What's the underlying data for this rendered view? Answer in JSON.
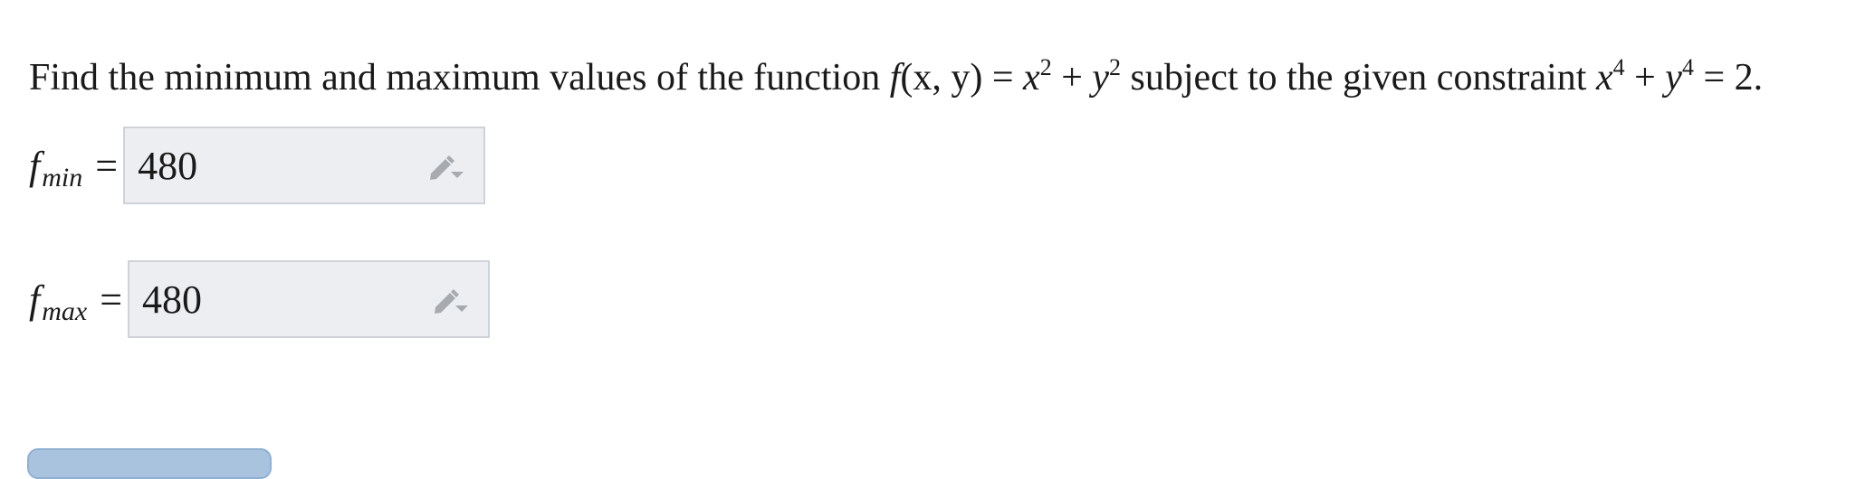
{
  "question": {
    "lead": "Find the minimum and maximum values of the function",
    "function_expr": {
      "f": "f",
      "args": "(x, y)",
      "eq": "=",
      "x": "x",
      "x_exp": "2",
      "plus": "+",
      "y": "y",
      "y_exp": "2"
    },
    "middle": "subject to the given constraint",
    "constraint_expr": {
      "x": "x",
      "x_exp": "4",
      "plus": "+",
      "y": "y",
      "y_exp": "4",
      "eq": "=",
      "rhs": "2."
    }
  },
  "answers": {
    "min": {
      "symbol": "f",
      "subscript": "min",
      "equals": "=",
      "value": "480"
    },
    "max": {
      "symbol": "f",
      "subscript": "max",
      "equals": "=",
      "value": "480"
    }
  },
  "icons": {
    "answer_edit": "pencil-dropdown-icon"
  },
  "colors": {
    "input_bg": "#eceef1",
    "input_border": "#cfd2d6",
    "icon": "#a7abb0",
    "button": "#a9c3df"
  }
}
